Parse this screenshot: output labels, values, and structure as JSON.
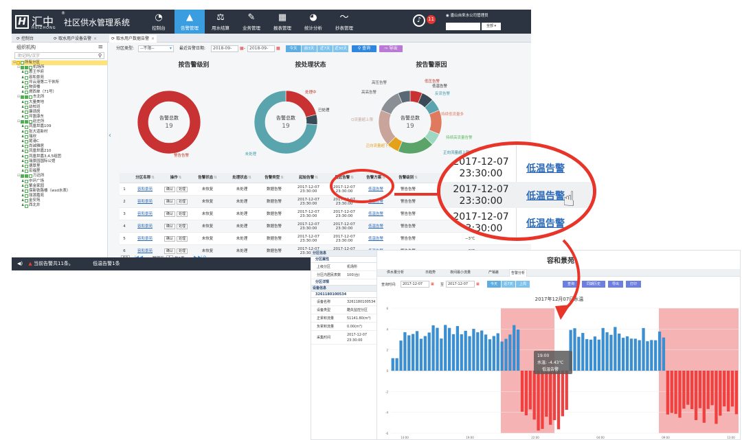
{
  "app": {
    "logo_mark": "H",
    "logo_cn": "汇中",
    "logo_en": "HUIZHONG",
    "logo_reg": "®",
    "title": "社区供水管理系统",
    "nav": [
      {
        "label": "控制台",
        "icon": "dashboard-icon",
        "glyph": "◔"
      },
      {
        "label": "告警管理",
        "icon": "warning-icon",
        "glyph": "▲"
      },
      {
        "label": "用水结算",
        "icon": "scale-icon",
        "glyph": "⚖"
      },
      {
        "label": "业务管理",
        "icon": "edit-icon",
        "glyph": "✎"
      },
      {
        "label": "报表管理",
        "icon": "table-icon",
        "glyph": "▦"
      },
      {
        "label": "统计分析",
        "icon": "pie-icon",
        "glyph": "◕"
      },
      {
        "label": "抄表管理",
        "icon": "rss-icon",
        "glyph": "〜"
      }
    ],
    "alarm_count": "11",
    "user": "唐山自来水公司管理员",
    "user_select": "全部"
  },
  "tabs": [
    {
      "label": "控制台",
      "closable": false
    },
    {
      "label": "取水用户设备告警",
      "closable": true
    },
    {
      "label": "取水用户数据告警",
      "closable": true
    }
  ],
  "sidebar": {
    "title": "组织机构",
    "search_placeholder": "助记码/汉字",
    "tree": [
      {
        "label": "所有分区",
        "level": 0,
        "type": "root",
        "selected": true
      },
      {
        "label": "机场所",
        "level": 1,
        "type": "group"
      },
      {
        "label": "惠王华府",
        "level": 2,
        "type": "leaf"
      },
      {
        "label": "容和景苑",
        "level": 2,
        "type": "leaf"
      },
      {
        "label": "坪云港第二干休所",
        "level": 2,
        "type": "leaf"
      },
      {
        "label": "物资楼",
        "level": 2,
        "type": "leaf"
      },
      {
        "label": "燃西单（71号）",
        "level": 2,
        "type": "leaf"
      },
      {
        "label": "东北所",
        "level": 1,
        "type": "group"
      },
      {
        "label": "大量美地",
        "level": 2,
        "type": "leaf"
      },
      {
        "label": "幼校班",
        "level": 2,
        "type": "leaf"
      },
      {
        "label": "廉颂居",
        "level": 2,
        "type": "leaf"
      },
      {
        "label": "坪篮康东",
        "level": 2,
        "type": "leaf"
      },
      {
        "label": "赵庄所",
        "level": 1,
        "type": "group"
      },
      {
        "label": "凤凰世嘉109",
        "level": 2,
        "type": "leaf"
      },
      {
        "label": "张大道新村",
        "level": 2,
        "type": "leaf"
      },
      {
        "label": "瑞欣",
        "level": 2,
        "type": "leaf"
      },
      {
        "label": "尾港C",
        "level": 2,
        "type": "leaf"
      },
      {
        "label": "尚诚雅居",
        "level": 2,
        "type": "leaf"
      },
      {
        "label": "凤凰世嘉210",
        "level": 2,
        "type": "leaf"
      },
      {
        "label": "凤凰世嘉3,4,5组团",
        "level": 2,
        "type": "leaf"
      },
      {
        "label": "瑞景园国际公馆",
        "level": 2,
        "type": "leaf"
      },
      {
        "label": "德厚里",
        "level": 2,
        "type": "leaf"
      },
      {
        "label": "宏福里",
        "level": 2,
        "type": "leaf"
      },
      {
        "label": "万达所",
        "level": 1,
        "type": "group"
      },
      {
        "label": "中环广场",
        "level": 2,
        "type": "leaf"
      },
      {
        "label": "紫金家园",
        "level": 2,
        "type": "leaf"
      },
      {
        "label": "保新铁路楼（wsd水表）",
        "level": 2,
        "type": "leaf"
      },
      {
        "label": "丽源嘉苑",
        "level": 2,
        "type": "leaf"
      },
      {
        "label": "金安苑",
        "level": 2,
        "type": "leaf"
      },
      {
        "label": "西北井",
        "level": 2,
        "type": "leaf"
      }
    ]
  },
  "filters": {
    "area_type_label": "分区类型:",
    "area_type_value": "--不限--",
    "date_label": "最近告警日期:",
    "date_from": "2018-09-",
    "date_to": "2018-09-",
    "sep": "-",
    "quick": [
      "今天",
      "前3天",
      "近7天",
      "近30天"
    ],
    "search": "查询",
    "export": "导出"
  },
  "charts": {
    "by_level": {
      "title": "按告警级别",
      "center_label": "告警总数",
      "center_value": "19"
    },
    "by_status": {
      "title": "按处理状态",
      "center_label": "告警总数",
      "center_value": "19"
    },
    "by_reason": {
      "title": "按告警原因",
      "center_label": "告警总数",
      "center_value": "19"
    }
  },
  "chart_data": [
    {
      "type": "pie",
      "title": "按告警级别",
      "categories": [
        "警告告警"
      ],
      "values": [
        19
      ]
    },
    {
      "type": "pie",
      "title": "按处理状态",
      "categories": [
        "处理中",
        "已处理",
        "未处理"
      ],
      "values": [
        4,
        1,
        14
      ]
    },
    {
      "type": "pie",
      "title": "按告警原因",
      "categories": [
        "低压告警",
        "低温告警",
        "反流告警",
        "持续低流量",
        "持续高流量告警",
        "正向流量超上限",
        "正向流量超下限",
        "Q流量超上限",
        "高压告警",
        "高高告警"
      ],
      "values": [
        1,
        1,
        1,
        2,
        1,
        3,
        1,
        3,
        2,
        1
      ]
    },
    {
      "type": "bar",
      "title": "2017年12月07日水温",
      "x": [
        "14:00",
        "19:00",
        "22:00",
        "04:00",
        "09:00",
        "13:00"
      ],
      "annotation": {
        "time": "19:00",
        "label": "水温: -4.43℃",
        "alarm": "低温告警"
      }
    }
  ],
  "pie_labels": {
    "level": [
      {
        "text": "警告告警",
        "color": "#c0392b"
      }
    ],
    "status": [
      {
        "text": "处理中",
        "color": "#c0392b"
      },
      {
        "text": "已处理",
        "color": "#333"
      },
      {
        "text": "未处理",
        "color": "#3f9aa8"
      }
    ],
    "reason": [
      {
        "text": "低压告警",
        "color": "#c0392b"
      },
      {
        "text": "低温告警",
        "color": "#333"
      },
      {
        "text": "反流告警",
        "color": "#3f9aa8"
      },
      {
        "text": "持续低流量多",
        "color": "#e07a5f"
      },
      {
        "text": "持续高流量告警",
        "color": "#5cb85c"
      },
      {
        "text": "正向流量超上限",
        "color": "#2f8a9a"
      },
      {
        "text": "正向流量超下限",
        "color": "#e3a21a"
      },
      {
        "text": "Q流量超上限",
        "color": "#c9a49a"
      },
      {
        "text": "高压告警",
        "color": "#555"
      },
      {
        "text": "高高告警",
        "color": "#555"
      }
    ]
  },
  "grid": {
    "headers": [
      "",
      "分区名称",
      "操作",
      "告警状态",
      "处理状态",
      "告警类型",
      "起始告警",
      "最近告警",
      "告警方案",
      "告警级别",
      "",
      "",
      "",
      ""
    ],
    "ops": [
      "确认",
      "处理"
    ],
    "rows": [
      {
        "n": "1",
        "area": "容和景苑",
        "alarm_status": "未恢复",
        "proc_status": "未处理",
        "type": "数据告警",
        "start": "2017-12-07 23:30:00",
        "recent": "2017-12-07 23:30:00",
        "plan": "低温告警",
        "level": "警告告警"
      },
      {
        "n": "2",
        "area": "容和景苑",
        "alarm_status": "未恢复",
        "proc_status": "未处理",
        "type": "数据告警",
        "start": "2017-12-07 23:30:00",
        "recent": "2017-12-07 23:30:00",
        "plan": "低温告警",
        "level": "警告告警"
      },
      {
        "n": "3",
        "area": "容和景苑",
        "alarm_status": "未恢复",
        "proc_status": "未处理",
        "type": "数据告警",
        "start": "2017-12-07 23:30:00",
        "recent": "2017-12-07 23:30:00",
        "plan": "低温告警",
        "level": "警告告警"
      },
      {
        "n": "4",
        "area": "容和景苑",
        "alarm_status": "未恢复",
        "proc_status": "未处理",
        "type": "数据告警",
        "start": "2017-12-07 23:30:00",
        "recent": "2017-12-07 23:30:00",
        "plan": "低温告警",
        "level": "警告告警"
      },
      {
        "n": "5",
        "area": "容和景苑",
        "alarm_status": "未恢复",
        "proc_status": "未处理",
        "type": "数据告警",
        "start": "2017-12-07 23:30:00",
        "recent": "2017-12-07 23:30:00",
        "plan": "低温告警",
        "level": "警告告警",
        "extra": "−3℃"
      },
      {
        "n": "6",
        "area": "容和景苑",
        "alarm_status": "未恢复",
        "proc_status": "未处理",
        "type": "数据告警",
        "start": "2017-12-07 23:30:00",
        "recent": "2017-12-07 23:30:00",
        "plan": "低温告警",
        "level": "警告告警",
        "extra": "−3℃"
      }
    ],
    "pager": {
      "size": "50",
      "goto": "跳转至",
      "page": "1",
      "total_pages": "共1页",
      "summary": "显示1到19,共19记录"
    }
  },
  "status": {
    "text": "当前告警共11条。",
    "alarm": "低温告警1条"
  },
  "zoom": {
    "rows": [
      {
        "time": "2017-12-07 23:30:00",
        "plan": "低温告警"
      },
      {
        "time": "2017-12-07 23:30:00",
        "plan": "低温告警"
      },
      {
        "time": "2017-12-07 23:30:00",
        "plan": "低温告警"
      }
    ]
  },
  "panel": {
    "title": "容和景苑",
    "left": {
      "section1": "分区信息",
      "sub1": "分区属性",
      "rows1": [
        {
          "k": "上级分区",
          "v": "机场所"
        },
        {
          "k": "分区内居民表数",
          "v": "100(台)"
        }
      ],
      "sub2": "分区详情",
      "section2": "设备信息",
      "device": "326118010​0534",
      "rows2": [
        {
          "k": "设备名称",
          "v": "3261180100534"
        },
        {
          "k": "设备类型",
          "v": "酷失监控分区"
        },
        {
          "k": "正累积流量",
          "v": "51141.80(m³)"
        },
        {
          "k": "负累积流量",
          "v": "0.00(m³)"
        },
        {
          "k": "采集时间",
          "v": "2017-12-07 23:30:00"
        }
      ]
    },
    "tabs": [
      "供水量分析",
      "日趋势",
      "夜间最小流量",
      "产销差",
      "告警分析"
    ],
    "query": {
      "label": "查询时间:",
      "from": "2017-12-07",
      "to_label": "至",
      "to": "2017-12-07",
      "quick": [
        "今天",
        "近7天",
        "上周"
      ],
      "buttons": [
        "查询",
        "同期历史",
        "导出",
        "打印"
      ]
    },
    "chart_title": "2017年12月07日水温",
    "tooltip": {
      "time": "19:00",
      "value": "水温: -4.43℃",
      "alarm": "低温告警"
    },
    "y_ticks": [
      "6",
      "4",
      "2",
      "0",
      "-2",
      "-4",
      "-6"
    ],
    "x_ticks": [
      "14:00",
      "19:00",
      "22:00",
      "04:00",
      "09:00",
      "13:00"
    ]
  }
}
